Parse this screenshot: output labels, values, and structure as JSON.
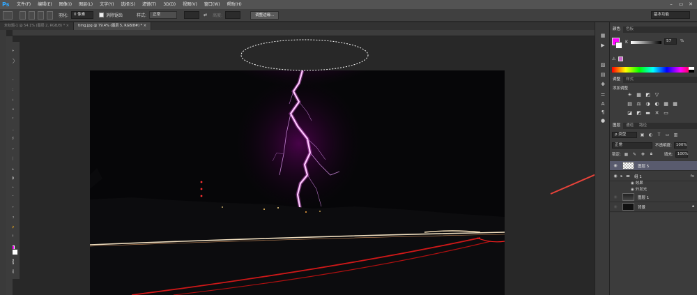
{
  "app": {
    "logo": "Ps",
    "menu": [
      "文件(F)",
      "编辑(E)",
      "图像(I)",
      "图层(L)",
      "文字(Y)",
      "选择(S)",
      "滤镜(T)",
      "3D(D)",
      "视图(V)",
      "窗口(W)",
      "帮助(H)"
    ],
    "window_controls": [
      "–",
      "▭",
      "✕"
    ]
  },
  "options_bar": {
    "feather_label": "羽化:",
    "feather_value": "0 像素",
    "antialias_label": "消除锯齿",
    "style_label": "样式:",
    "style_value": "正常",
    "width_label": "宽度:",
    "height_label": "高度:",
    "refine_button": "调整边缘...",
    "workspace": "基本功能"
  },
  "tabs": [
    {
      "label": "未标题-1 @ 54.1% (图层 2, RGB/8) * ×",
      "active": false
    },
    {
      "label": "timg.jpg @ 79.4% (图层 5, RGB/8#) * ×",
      "active": true
    }
  ],
  "color_panel": {
    "tabs": [
      "颜色",
      "色板"
    ],
    "k_label": "K",
    "k_value": "57",
    "k_unit": "%",
    "foreground": "#ff00ff",
    "background": "#ffffff"
  },
  "adjust_panel": {
    "tabs": [
      "调整",
      "样式"
    ],
    "title": "添加调整",
    "icons": [
      [
        "☀",
        "▦",
        "◩",
        "▽"
      ],
      [
        "▤",
        "⚖",
        "◑",
        "◐",
        "▦",
        "▦"
      ],
      [
        "◪",
        "◩",
        "▬",
        "✕",
        "▭"
      ]
    ]
  },
  "layers_panel": {
    "tabs": [
      "图层",
      "通道",
      "路径"
    ],
    "filter": "ρ 类型",
    "blend_mode": "正常",
    "opacity_label": "不透明度:",
    "opacity_value": "100%",
    "lock_label": "锁定:",
    "fill_label": "填充:",
    "fill_value": "100%",
    "layers": [
      {
        "name": "图层 5",
        "selected": true,
        "thumb": "trans"
      },
      {
        "name": "组 1",
        "selected": false,
        "thumb": "folder",
        "fx": "fx"
      },
      {
        "name": "图层 1",
        "selected": false,
        "thumb": "photo"
      },
      {
        "name": "背景",
        "selected": false,
        "thumb": "dark"
      }
    ],
    "effects_label": "效果",
    "effect_name": "外发光"
  },
  "accent": "#e8433a"
}
